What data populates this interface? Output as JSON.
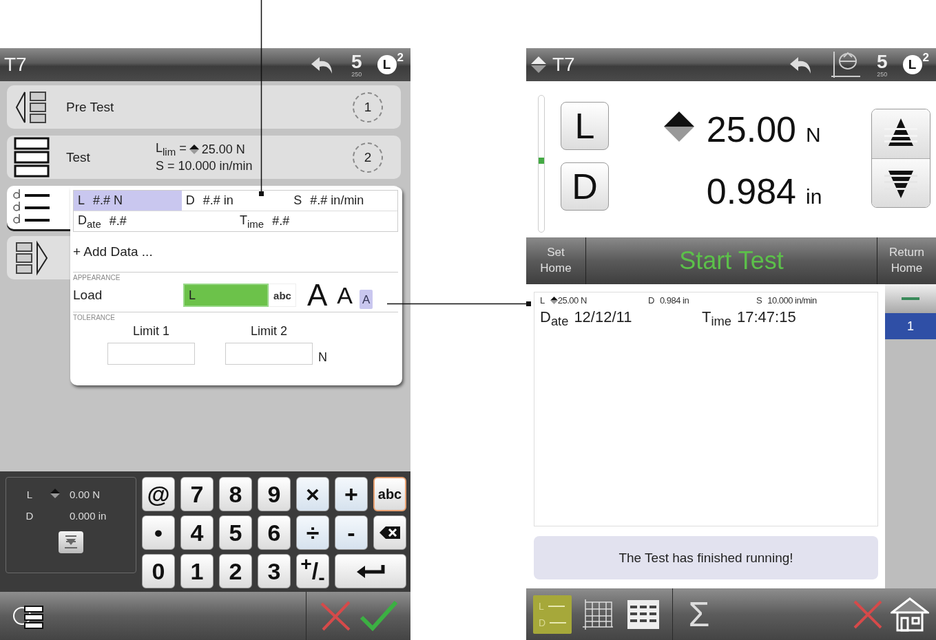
{
  "left_screen": {
    "header": {
      "title": "T7",
      "speed": "5",
      "speed_sub": "250",
      "load": "L",
      "load_count": "2"
    },
    "steps": [
      {
        "kind": "pre",
        "label": "Pre Test",
        "badge": "1",
        "selected": false
      },
      {
        "kind": "test",
        "label": "Test",
        "limit_label": "L$_{lim}$ =",
        "limit_value": "25.00 N",
        "speed": "S = 10.000 in/min",
        "badge": "2",
        "selected": false
      },
      {
        "kind": "data",
        "selected": true
      },
      {
        "kind": "post",
        "selected": false
      }
    ],
    "popup": {
      "fields": [
        [
          {
            "label": "L",
            "value": "#.# N",
            "selected": true
          },
          {
            "label": "D",
            "value": "#.# in",
            "selected": false
          },
          {
            "label": "S",
            "value": "#.# in/min",
            "selected": false
          }
        ],
        [
          {
            "label": "D$_{ate}$",
            "value": "#.#",
            "selected": false
          },
          {
            "label": "T$_{ime}$",
            "value": "#.#",
            "selected": false
          }
        ]
      ],
      "add_data": "+ Add Data ...",
      "appearance": {
        "heading": "APPEARANCE",
        "label": "Load",
        "value": "L",
        "keyboard": "abc",
        "sizes": [
          {
            "kind": "large",
            "label": "A",
            "selected": false
          },
          {
            "kind": "medium",
            "label": "A",
            "selected": false
          },
          {
            "kind": "small",
            "label": "A",
            "selected": true
          }
        ]
      },
      "tolerance": {
        "heading": "TOLERANCE",
        "limits": [
          {
            "label": "Limit 1"
          },
          {
            "label": "Limit 2"
          }
        ],
        "unit": "N"
      }
    },
    "readout": [
      {
        "label": "L",
        "value": "0.00 N",
        "indicator": true
      },
      {
        "label": "D",
        "value": "0.000 in",
        "indicator": false
      }
    ],
    "keys": [
      {
        "kind": "char",
        "label": "@"
      },
      {
        "kind": "char",
        "label": "7"
      },
      {
        "kind": "char",
        "label": "8"
      },
      {
        "kind": "char",
        "label": "9"
      },
      {
        "kind": "op",
        "label": "×"
      },
      {
        "kind": "op",
        "label": "+"
      },
      {
        "kind": "mode",
        "label": "abc"
      },
      {
        "kind": "char",
        "label": "•"
      },
      {
        "kind": "char",
        "label": "4"
      },
      {
        "kind": "char",
        "label": "5"
      },
      {
        "kind": "char",
        "label": "6"
      },
      {
        "kind": "op",
        "label": "÷"
      },
      {
        "kind": "op",
        "label": "-"
      },
      {
        "kind": "backspace"
      },
      {
        "kind": "char",
        "label": "0"
      },
      {
        "kind": "char",
        "label": "1"
      },
      {
        "kind": "char",
        "label": "2"
      },
      {
        "kind": "char",
        "label": "3"
      },
      {
        "kind": "char",
        "label": "$^{+}$/$_{-}$"
      },
      {
        "kind": "enter"
      }
    ]
  },
  "right_screen": {
    "header": {
      "title": "T7",
      "speed": "5",
      "speed_sub": "250",
      "load": "L",
      "load_count": "2"
    },
    "readout": {
      "rows": [
        {
          "key": "L",
          "value": "25.00",
          "unit": "N",
          "indicator": true
        },
        {
          "key": "D",
          "value": "0.984",
          "unit": "in",
          "indicator": false
        }
      ],
      "position": {
        "level": 0.52
      }
    },
    "actions": [
      {
        "kind": "side",
        "label": "Set Home"
      },
      {
        "kind": "main",
        "label": "Start Test"
      },
      {
        "kind": "side",
        "label": "Return Home"
      }
    ],
    "results": {
      "fields": [
        {
          "label": "L",
          "value": "25.00 N",
          "indicator": true
        },
        {
          "label": "D",
          "value": "0.984 in",
          "indicator": false
        },
        {
          "label": "S",
          "value": "10.000 in/min",
          "indicator": false
        }
      ],
      "date_label": "D$_{ate}$",
      "date": "12/12/11",
      "time_label": "T$_{ime}$",
      "time": "17:47:15"
    },
    "message": "The Test has finished running!",
    "tests": [
      {
        "kind": "all",
        "selected": false
      },
      {
        "kind": "number",
        "label": "1",
        "selected": true
      }
    ],
    "toolbar": [
      {
        "kind": "ld",
        "labels": [
          "L",
          "D"
        ],
        "selected": true
      },
      {
        "kind": "graph",
        "selected": false
      },
      {
        "kind": "table",
        "selected": false
      },
      {
        "kind": "stats",
        "label": "Σ",
        "selected": false
      }
    ]
  }
}
